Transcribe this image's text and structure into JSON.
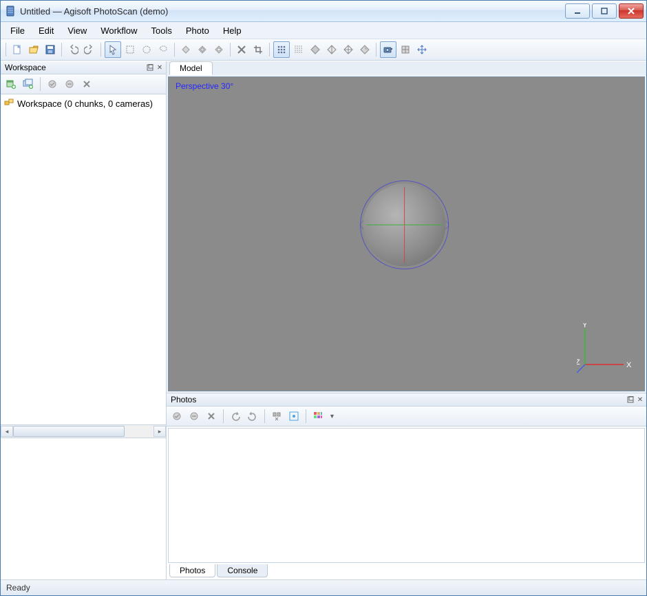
{
  "titlebar": {
    "title": "Untitled — Agisoft PhotoScan (demo)"
  },
  "menubar": {
    "items": [
      "File",
      "Edit",
      "View",
      "Workflow",
      "Tools",
      "Photo",
      "Help"
    ]
  },
  "workspace": {
    "title": "Workspace",
    "root_label": "Workspace (0 chunks, 0 cameras)"
  },
  "model": {
    "tab_label": "Model",
    "viewport_label": "Perspective 30°",
    "axis": {
      "x": "X",
      "y": "Y",
      "z": "Z"
    }
  },
  "photos": {
    "title": "Photos",
    "bottom_tabs": {
      "photos": "Photos",
      "console": "Console"
    }
  },
  "status": {
    "text": "Ready"
  }
}
